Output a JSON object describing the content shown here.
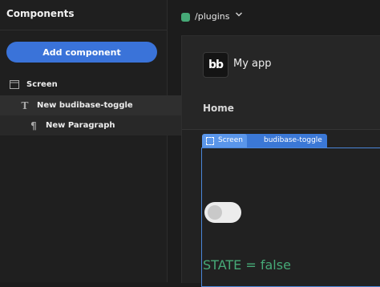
{
  "components_panel": {
    "title": "Components",
    "add_button": "Add component",
    "tree": [
      {
        "label": "Screen",
        "icon": "screen-icon"
      },
      {
        "label": "New budibase-toggle",
        "icon": "text-icon"
      },
      {
        "label": "New Paragraph",
        "icon": "paragraph-icon"
      }
    ]
  },
  "route": {
    "label": "/plugins",
    "color": "#46a977"
  },
  "app": {
    "logo": "bb",
    "title": "My app",
    "nav_item": "Home"
  },
  "canvas": {
    "badge_screen": "Screen",
    "badge_component": "budibase-toggle",
    "toggle_on": false,
    "state_text": "STATE = false"
  },
  "colors": {
    "accent": "#3a73d9",
    "selection_border": "#4a86d9",
    "state_green": "#46a977"
  }
}
